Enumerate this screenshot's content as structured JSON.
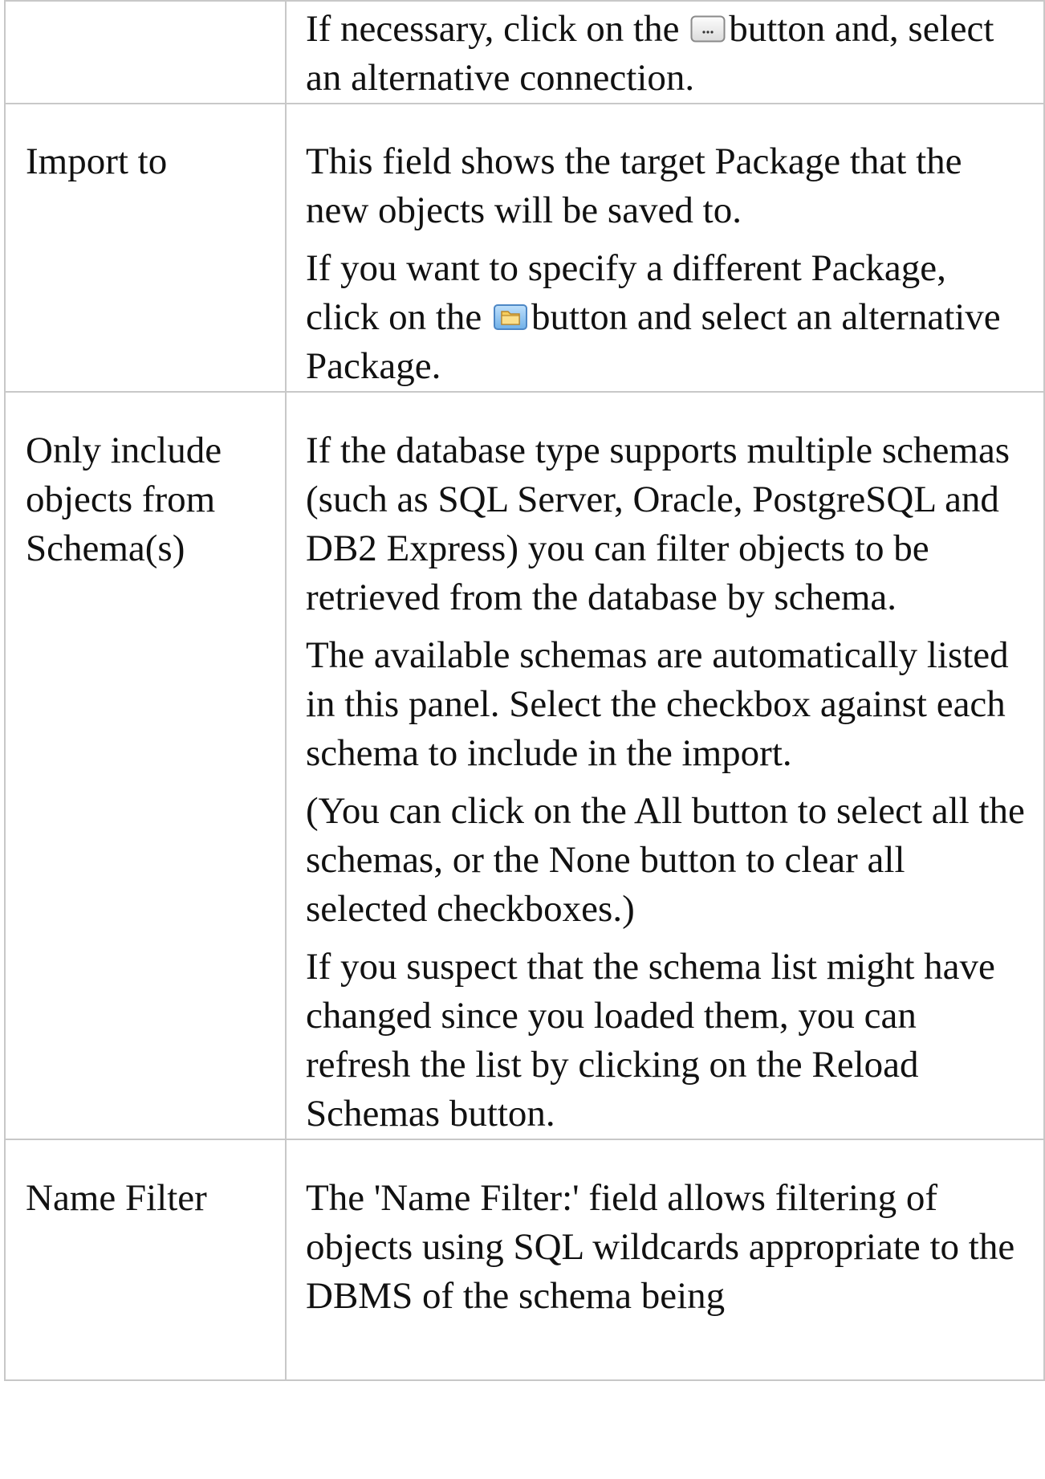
{
  "rows": [
    {
      "label": "",
      "paragraphs": [
        {
          "before": "If necessary, click on the",
          "icon": "ellipsis-button-icon",
          "after": "button and, select an alternative connection."
        }
      ]
    },
    {
      "label": "Import to",
      "paragraphs": [
        {
          "text": "This field shows the target Package that the new objects will be saved to."
        },
        {
          "before": "If you want to specify a different Package, click on the",
          "icon": "folder-browse-icon",
          "after": "button and select an alternative Package."
        }
      ]
    },
    {
      "label": "Only include objects from Schema(s)",
      "paragraphs": [
        {
          "text": "If the database type supports multiple schemas (such as SQL Server, Oracle, PostgreSQL and DB2 Express) you can filter objects to be retrieved from the database by schema."
        },
        {
          "text": "The available schemas are automatically listed in this panel. Select the checkbox against each schema to include in the import."
        },
        {
          "text": "(You can click on the All button to select all the schemas, or the None button to clear all selected checkboxes.)"
        },
        {
          "text": "If you suspect that the schema list might have changed since you loaded them, you can refresh the list by clicking on the Reload Schemas button."
        }
      ]
    },
    {
      "label": "Name Filter",
      "paragraphs": [
        {
          "text": "The 'Name Filter:' field allows filtering of objects using SQL wildcards appropriate to the DBMS of the schema being"
        }
      ]
    }
  ]
}
